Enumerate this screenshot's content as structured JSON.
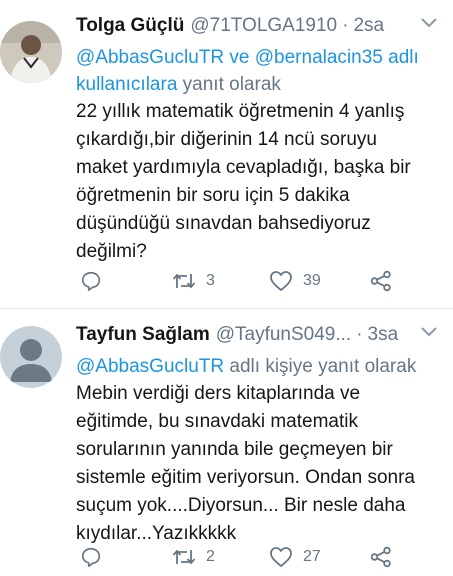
{
  "tweets": [
    {
      "name": "Tolga Güçlü",
      "handle": "@71TOLGA1910",
      "time": "2sa",
      "reply_mention_1": "@AbbasGucluTR",
      "reply_connector": "ve",
      "reply_mention_2": "@bernalacin35",
      "reply_mid": "adlı",
      "reply_users": "kullanıcılara",
      "reply_suffix": "yanıt olarak",
      "body_lines": [
        "22 yıllık matematik öğretmenin 4 yanlış",
        "çıkardığı,bir diğerinin 14 ncü soruyu",
        "maket yardımıyla cevapladığı, başka bir",
        "öğretmenin bir soru için 5 dakika",
        "düşündüğü sınavdan bahsediyoruz",
        "değilmi?"
      ],
      "retweet_count": "3",
      "like_count": "39"
    },
    {
      "name": "Tayfun Sağlam",
      "handle": "@TayfunS049...",
      "time": "3sa",
      "reply_mention_1": "@AbbasGucluTR",
      "reply_suffix": "adlı kişiye yanıt olarak",
      "body_lines": [
        "Mebin verdiği ders kitaplarında ve",
        "eğitimde,  bu sınavdaki matematik",
        "sorularının yanında bile geçmeyen bir",
        "sistemle eğitim veriyorsun. Ondan sonra",
        "suçum yok....Diyorsun... Bir nesle daha",
        "kıydılar...Yazıkkkkk"
      ],
      "retweet_count": "2",
      "like_count": "27"
    }
  ],
  "icons": {
    "reply": "reply-icon",
    "retweet": "retweet-icon",
    "like": "heart-icon",
    "share": "share-icon",
    "caret": "chevron-down-icon"
  },
  "colors": {
    "link": "#1b95e0",
    "secondary_text": "#657786",
    "primary_text": "#14171a",
    "divider": "#e1e8ed"
  }
}
